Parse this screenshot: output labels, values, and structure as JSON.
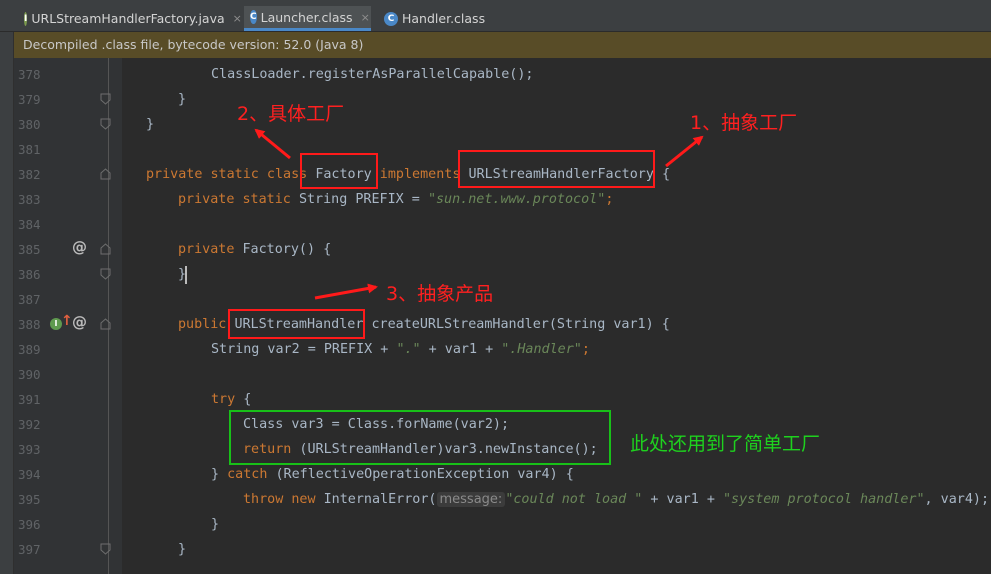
{
  "tabs": [
    {
      "label": "URLStreamHandlerFactory.java",
      "icon": "I",
      "icon_color": "#7c9b4e",
      "active": false
    },
    {
      "label": "Launcher.class",
      "icon": "C",
      "icon_color": "#4a88c7",
      "active": true
    },
    {
      "label": "Handler.class",
      "icon": "C",
      "icon_color": "#4a88c7",
      "active": false
    }
  ],
  "close_glyph": "×",
  "banner": "Decompiled .class file, bytecode version: 52.0 (Java 8)",
  "line_numbers": [
    "378",
    "379",
    "380",
    "381",
    "382",
    "383",
    "384",
    "385",
    "386",
    "387",
    "388",
    "389",
    "390",
    "391",
    "392",
    "393",
    "394",
    "395",
    "396",
    "397"
  ],
  "code": {
    "l378": "ClassLoader.registerAsParallelCapable();",
    "l379": "}",
    "l380": "}",
    "l382_kw": "private static class ",
    "l382_name": "Factory",
    "l382_impl": " implements ",
    "l382_iface": "URLStreamHandlerFactory",
    "l382_brace": " {",
    "l383_kw": "private static ",
    "l383_type": "String PREFIX = ",
    "l383_str": "\"sun.net.www.protocol\"",
    "l383_end": ";",
    "l385_kw": "private ",
    "l385_rest": "Factory() {",
    "l386": "}",
    "l388_kw": "public ",
    "l388_type": "URLStreamHandler",
    "l388_rest": " createURLStreamHandler(String var1) {",
    "l389_a": "String var2 = PREFIX + ",
    "l389_s1": "\".\"",
    "l389_b": " + var1 + ",
    "l389_s2": "\".Handler\"",
    "l389_end": ";",
    "l391_kw": "try",
    "l391_rest": " {",
    "l392": "Class var3 = Class.forName(var2);",
    "l393_kw": "return",
    "l393_rest": " (URLStreamHandler)var3.newInstance();",
    "l394_a": "} ",
    "l394_kw": "catch",
    "l394_rest": " (ReflectiveOperationException var4) {",
    "l395_kw": "throw new ",
    "l395_a": "InternalError(",
    "l395_hint": "message:",
    "l395_s1": "\"could not load \"",
    "l395_b": " + var1 + ",
    "l395_s2": "\"system protocol handler\"",
    "l395_c": ", var4);",
    "l396": "}",
    "l397": "}"
  },
  "gutter_markers": {
    "at_symbol": "@",
    "override_up": "↑",
    "override_badge": "I"
  },
  "annotations": {
    "abstract_factory": "1、抽象工厂",
    "concrete_factory": "2、具体工厂",
    "abstract_product": "3、抽象产品",
    "simple_factory": "此处还用到了简单工厂"
  },
  "colors": {
    "background": "#2b2b2b",
    "keyword": "#cc7832",
    "string": "#6a8759",
    "annotation_red": "#ff1a1a",
    "annotation_green": "#18c018"
  }
}
